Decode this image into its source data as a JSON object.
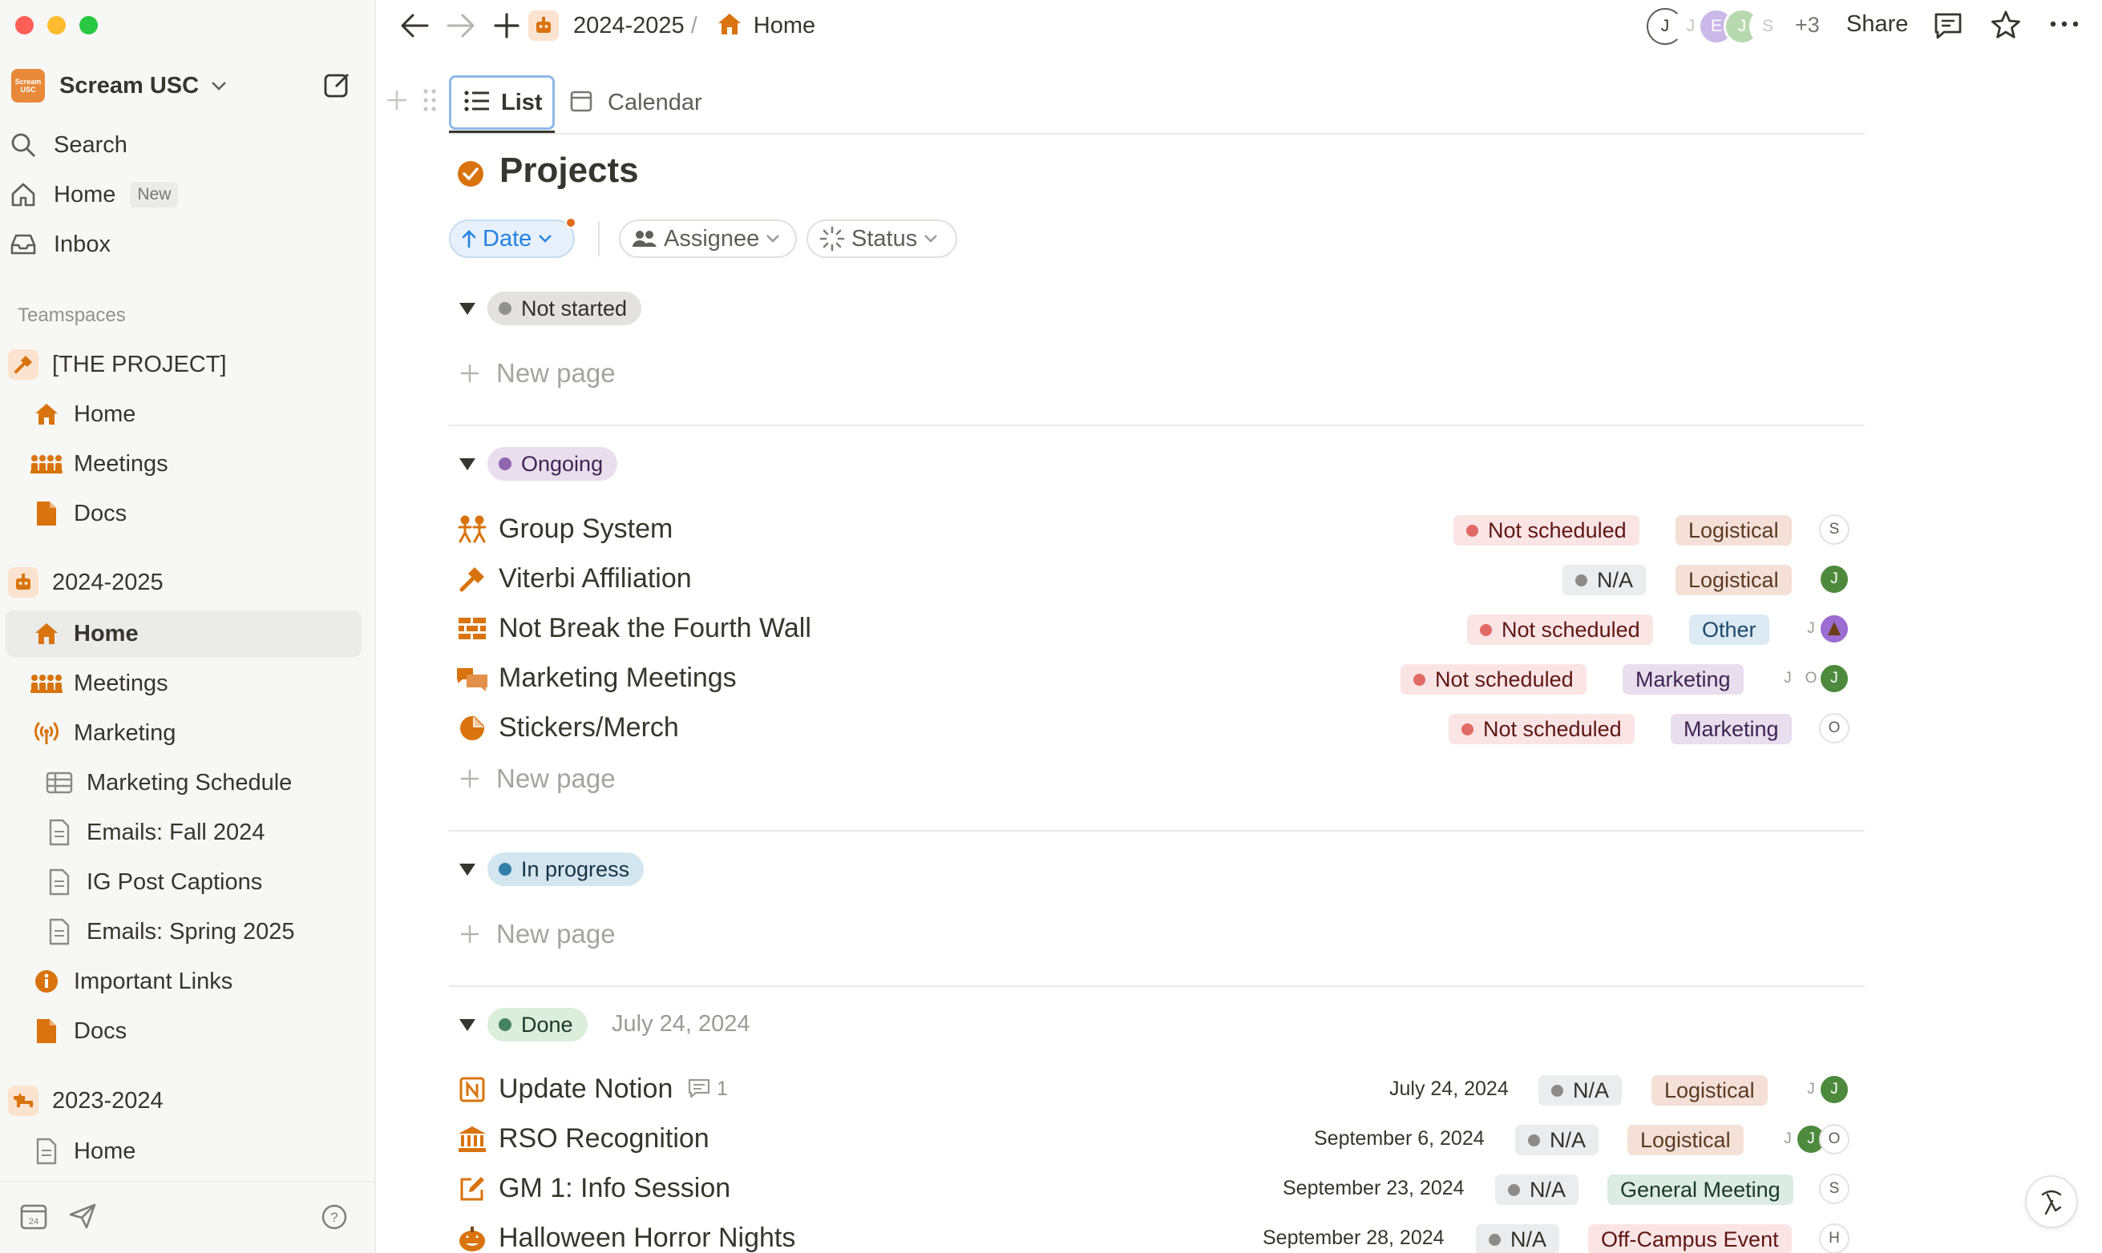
{
  "window": {
    "traffic_colors": [
      "#ff5f57",
      "#febc2e",
      "#28c840"
    ]
  },
  "sidebar": {
    "workspace_name": "Scream USC",
    "workspace_logo_text": "Scream USC",
    "top_items": [
      {
        "label": "Search",
        "icon": "search-icon"
      },
      {
        "label": "Home",
        "icon": "home-icon",
        "badge": "New"
      },
      {
        "label": "Inbox",
        "icon": "inbox-icon"
      }
    ],
    "section_heading": "Teamspaces",
    "teamspaces": [
      {
        "label": "[THE PROJECT]",
        "icon": "hammer-icon",
        "items": [
          {
            "label": "Home",
            "icon": "house-icon"
          },
          {
            "label": "Meetings",
            "icon": "people-icon"
          },
          {
            "label": "Docs",
            "icon": "doc-icon"
          }
        ]
      },
      {
        "label": "2024-2025",
        "icon": "robot-icon",
        "items": [
          {
            "label": "Home",
            "icon": "house-icon",
            "active": true
          },
          {
            "label": "Meetings",
            "icon": "people-icon"
          },
          {
            "label": "Marketing",
            "icon": "broadcast-icon"
          },
          {
            "label": "Marketing Schedule",
            "icon": "table-icon"
          },
          {
            "label": "Emails: Fall 2024",
            "icon": "page-icon"
          },
          {
            "label": "IG Post Captions",
            "icon": "page-icon"
          },
          {
            "label": "Emails: Spring 2025",
            "icon": "page-icon"
          },
          {
            "label": "Important Links",
            "icon": "info-icon"
          },
          {
            "label": "Docs",
            "icon": "doc-icon"
          }
        ]
      },
      {
        "label": "2023-2024",
        "icon": "dog-icon",
        "items": [
          {
            "label": "Home",
            "icon": "page-icon"
          }
        ]
      }
    ]
  },
  "topbar": {
    "breadcrumb_parent": "2024-2025",
    "breadcrumb_sep": "/",
    "breadcrumb_current": "Home",
    "avatars": [
      "J",
      "J",
      "E",
      "J",
      "S"
    ],
    "extra_count": "+3",
    "share_label": "Share"
  },
  "views": {
    "tabs": [
      {
        "label": "List",
        "icon": "list-icon",
        "active": true
      },
      {
        "label": "Calendar",
        "icon": "calendar-icon",
        "active": false
      }
    ]
  },
  "database": {
    "title": "Projects",
    "filters": {
      "date": "Date",
      "assignee": "Assignee",
      "status": "Status"
    },
    "new_page_label": "New page",
    "groups": {
      "not_started": {
        "label": "Not started",
        "color": "#e3e2e0",
        "dot": "#91918e"
      },
      "ongoing": {
        "label": "Ongoing",
        "color": "#e8deee",
        "dot": "#9065b0",
        "rows": [
          {
            "title": "Group System",
            "icon": "group-icon",
            "schedule": "Not scheduled",
            "tag": "Logistical",
            "assignees": [
              "S"
            ]
          },
          {
            "title": "Viterbi Affiliation",
            "icon": "hammer-icon",
            "schedule": "N/A",
            "tag": "Logistical",
            "assignees": [
              "J"
            ]
          },
          {
            "title": "Not Break the Fourth Wall",
            "icon": "wall-icon",
            "schedule": "Not scheduled",
            "tag": "Other",
            "assignees": [
              "J",
              "avatar"
            ]
          },
          {
            "title": "Marketing Meetings",
            "icon": "chat-icon",
            "schedule": "Not scheduled",
            "tag": "Marketing",
            "assignees": [
              "J",
              "O",
              "J"
            ]
          },
          {
            "title": "Stickers/Merch",
            "icon": "sticker-icon",
            "schedule": "Not scheduled",
            "tag": "Marketing",
            "assignees": [
              "O"
            ]
          }
        ]
      },
      "in_progress": {
        "label": "In progress",
        "color": "#d3e5ef",
        "dot": "#337ea9"
      },
      "done": {
        "label": "Done",
        "date": "July 24, 2024",
        "color": "#dbeddb",
        "dot": "#448361",
        "rows": [
          {
            "title": "Update Notion",
            "icon": "notion-icon",
            "comments": "1",
            "date": "July 24, 2024",
            "schedule": "N/A",
            "tag": "Logistical",
            "assignees": [
              "J",
              "J"
            ]
          },
          {
            "title": "RSO Recognition",
            "icon": "bank-icon",
            "date": "September 6, 2024",
            "schedule": "N/A",
            "tag": "Logistical",
            "assignees": [
              "J",
              "J",
              "O"
            ]
          },
          {
            "title": "GM 1: Info Session",
            "icon": "edit-icon",
            "date": "September 23, 2024",
            "schedule": "N/A",
            "tag": "General Meeting",
            "assignees": [
              "S"
            ]
          },
          {
            "title": "Halloween Horror Nights",
            "icon": "pumpkin-icon",
            "date": "September 28, 2024",
            "schedule": "N/A",
            "tag": "Off-Campus Event",
            "assignees": [
              "H"
            ]
          }
        ]
      }
    }
  },
  "colors": {
    "accent_orange": "#d9730d",
    "link_blue": "#2383e2"
  }
}
